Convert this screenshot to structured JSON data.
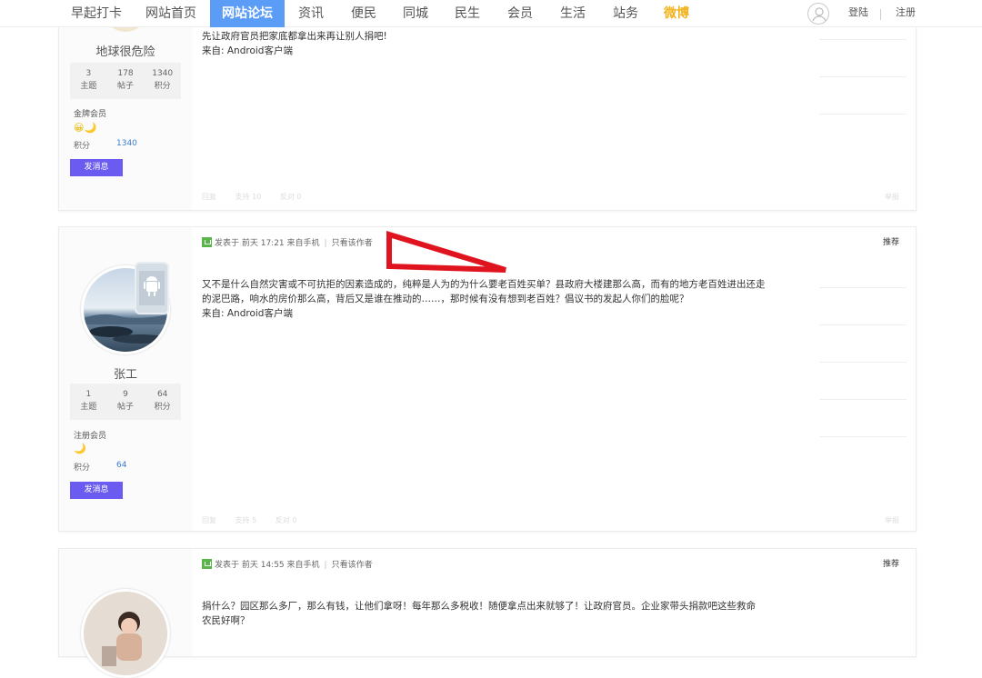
{
  "nav": {
    "items": [
      {
        "label": "早起打卡"
      },
      {
        "label": "网站首页"
      },
      {
        "label": "网站论坛"
      },
      {
        "label": "资讯"
      },
      {
        "label": "便民"
      },
      {
        "label": "同城"
      },
      {
        "label": "民生"
      },
      {
        "label": "会员"
      },
      {
        "label": "生活"
      },
      {
        "label": "站务"
      },
      {
        "label": "微博"
      }
    ],
    "login": "登陆",
    "register": "注册"
  },
  "posts": [
    {
      "username": "地球很危险",
      "stats": [
        {
          "value": "3",
          "label": "主题"
        },
        {
          "value": "178",
          "label": "帖子"
        },
        {
          "value": "1340",
          "label": "积分"
        }
      ],
      "rank": "金牌会员",
      "medals": "😀🌙",
      "points_label": "积分",
      "points": "1340",
      "message_button": "发消息",
      "lines": [
        "先让政府官员把家底都拿出来再让别人捐吧!",
        "来自: Android客户端"
      ],
      "actions": [
        "回复",
        "支持 10",
        "反对 0"
      ],
      "report": "举报"
    },
    {
      "username": "张工",
      "stats": [
        {
          "value": "1",
          "label": "主题"
        },
        {
          "value": "9",
          "label": "帖子"
        },
        {
          "value": "64",
          "label": "积分"
        }
      ],
      "rank": "注册会员",
      "medals": "🌙",
      "points_label": "积分",
      "points": "64",
      "message_button": "发消息",
      "meta_posted": "发表于 前天 17:21 来自手机",
      "meta_author_only": "只看该作者",
      "recommend": "推荐",
      "lines": [
        "又不是什么自然灾害或不可抗拒的因素造成的，纯粹是人为的为什么要老百姓买单？县政府大楼建那么高，而有的地方老百姓进出还走",
        "的泥巴路，响水的房价那么高，背后又是谁在推动的……，那时候有没有想到老百姓？倡议书的发起人你们的脸呢？",
        "来自: Android客户端"
      ],
      "actions": [
        "回复",
        "支持 5",
        "反对 0"
      ],
      "report": "举报"
    },
    {
      "meta_posted": "发表于 前天 14:55 来自手机",
      "meta_author_only": "只看该作者",
      "recommend": "推荐",
      "lines": [
        "捐什么？园区那么多厂，那么有钱，让他们拿呀！每年那么多税收！随便拿点出来就够了！让政府官员。企业家带头捐款吧这些救命",
        "农民好啊？"
      ]
    }
  ],
  "colors": {
    "nav_active": "#5b9cf6",
    "weibo": "#f3b21b",
    "message_button": "#6b5bf0",
    "annotation": "#e0141e"
  }
}
